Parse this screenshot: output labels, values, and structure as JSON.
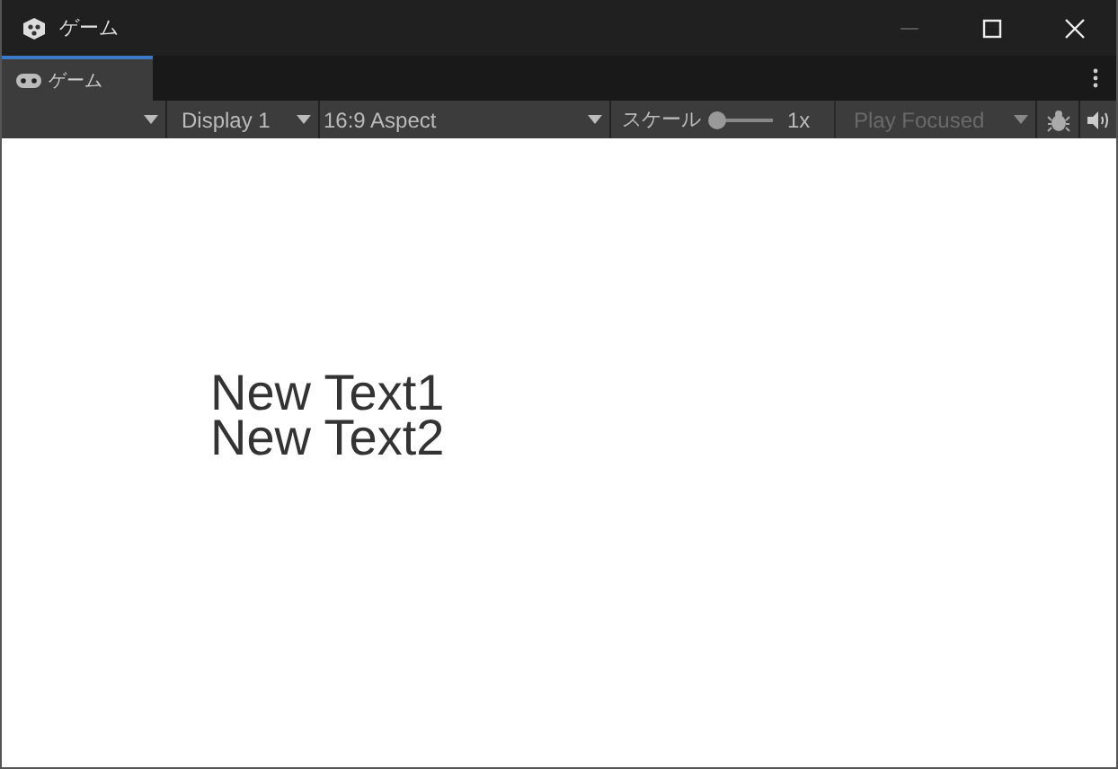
{
  "window": {
    "title": "ゲーム",
    "minimize_disabled": true
  },
  "tabs": [
    {
      "label": "ゲーム",
      "selected": true
    }
  ],
  "toolbar": {
    "display": "Display 1",
    "aspect": "16:9 Aspect",
    "scale_label": "スケール",
    "scale": {
      "level": 0.05
    },
    "scale_reading": "1x",
    "play_mode": {
      "label": "Play Focused",
      "disabled": true
    }
  },
  "game_view": {
    "texts": [
      "New Text1",
      "New Text2"
    ]
  }
}
